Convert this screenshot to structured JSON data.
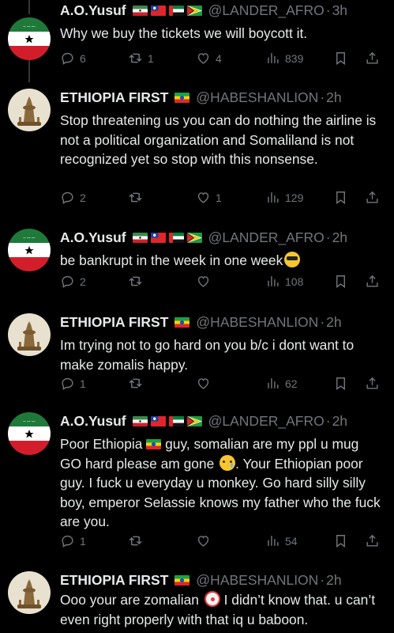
{
  "tweets": [
    {
      "name": "A.O.Yusuf",
      "handle": "@LANDER_AFRO",
      "sep": "·",
      "time": "3h",
      "text": "Why we buy the tickets we will boycott it.",
      "replies": "6",
      "retweets": "1",
      "likes": "4",
      "views": "839"
    },
    {
      "name": "ETHIOPIA FIRST",
      "handle": "@HABESHANLION",
      "sep": "·",
      "time": "2h",
      "text": "Stop threatening us you can do nothing the airline is not a political organization and Somaliland is not recognized yet so stop with this nonsense.",
      "replies": "2",
      "retweets": "",
      "likes": "1",
      "views": "129"
    },
    {
      "name": "A.O.Yusuf",
      "handle": "@LANDER_AFRO",
      "sep": "·",
      "time": "2h",
      "text": "be bankrupt in the week in one week",
      "replies": "2",
      "retweets": "",
      "likes": "",
      "views": "108"
    },
    {
      "name": "ETHIOPIA FIRST",
      "handle": "@HABESHANLION",
      "sep": "·",
      "time": "2h",
      "text": "Im trying not to go hard on you b/c i dont want to make zomalis happy.",
      "replies": "1",
      "retweets": "",
      "likes": "",
      "views": "62"
    },
    {
      "name": "A.O.Yusuf",
      "handle": "@LANDER_AFRO",
      "sep": "·",
      "time": "2h",
      "text_a": "Poor Ethiopia",
      "text_b": " guy, somalian are  my ppl u mug GO hard please am gone",
      "text_c": ". Your Ethiopian poor guy. I fuck u everyday u monkey. Go hard silly silly boy, emperor Selassie knows my father who the fuck are you.",
      "replies": "1",
      "retweets": "",
      "likes": "",
      "views": "54"
    },
    {
      "name": "ETHIOPIA FIRST",
      "handle": "@HABESHANLION",
      "sep": "·",
      "time": "2h",
      "text_a": "Ooo your are zomalian",
      "text_b": " I didn’t know that. u can’t even right properly with that iq u baboon."
    }
  ],
  "colors": {
    "background": "#000000",
    "text": "#e7e9ea",
    "muted": "#71767b",
    "thread_line": "#333639"
  },
  "icons": [
    "reply-icon",
    "retweet-icon",
    "like-icon",
    "views-icon",
    "bookmark-icon",
    "share-icon",
    "sunglasses-emoji",
    "crying-emoji",
    "clown-emoji",
    "somaliland-flag",
    "taiwan-flag",
    "uae-flag",
    "guyana-flag",
    "ethiopia-flag"
  ]
}
